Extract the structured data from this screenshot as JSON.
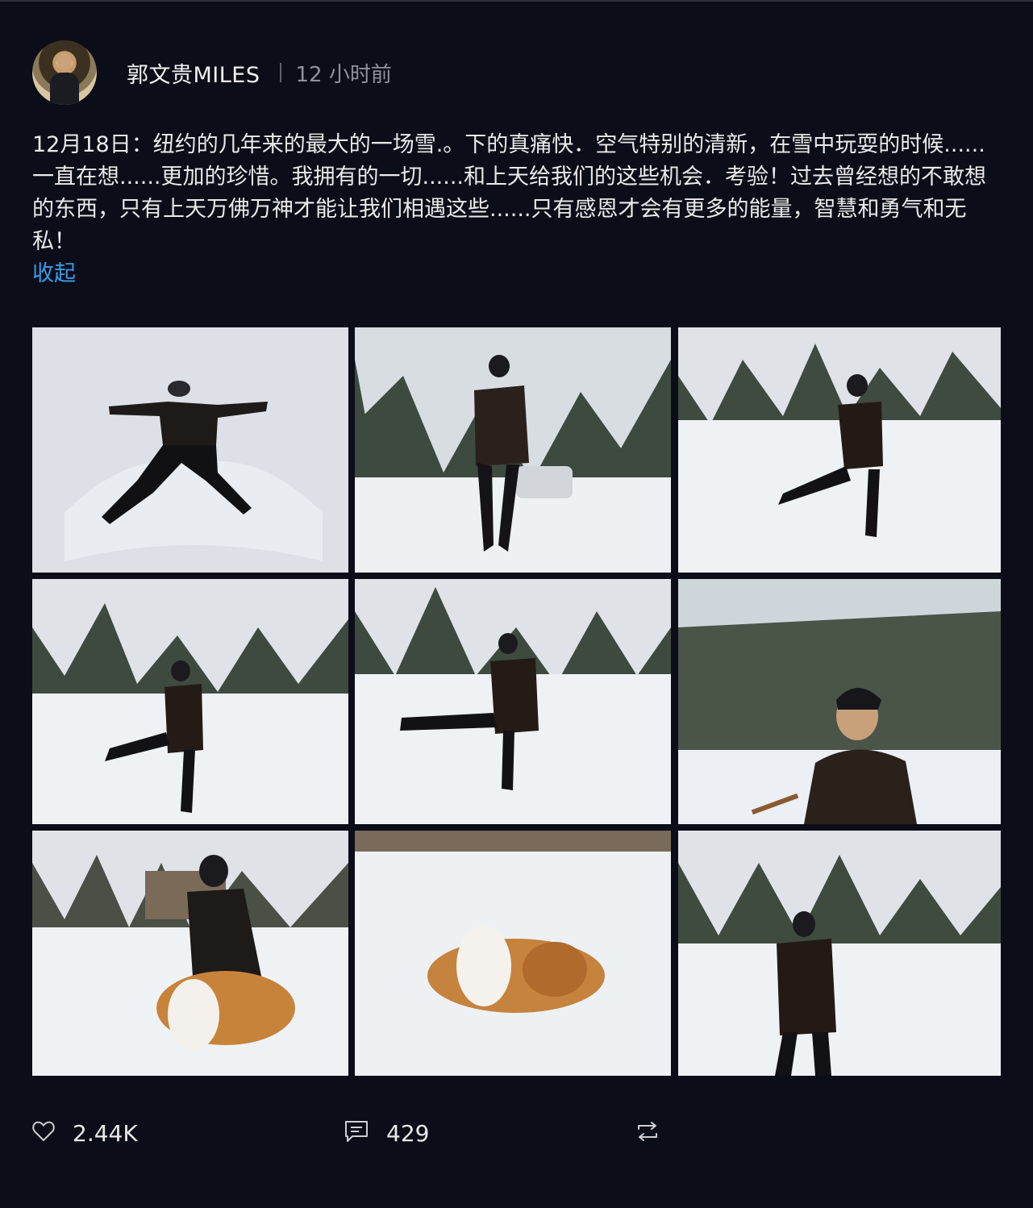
{
  "post": {
    "author": "郭文贵MILES",
    "time": "12 小时前",
    "text": "12月18日：纽约的几年来的最大的一场雪.。下的真痛快．空气特别的清新，在雪中玩耍的时候......一直在想......更加的珍惜。我拥有的一切......和上天给我们的这些机会．考验！过去曾经想的不敢想的东西，只有上天万佛万神才能让我们相遇这些......只有感恩才会有更多的能量，智慧和勇气和无私！",
    "collapse_label": "收起"
  },
  "photos": [
    {
      "name": "snow-angel-photo"
    },
    {
      "name": "standing-cigar-photo"
    },
    {
      "name": "kicking-snow-photo-1"
    },
    {
      "name": "kicking-snow-photo-2"
    },
    {
      "name": "kicking-snow-photo-3"
    },
    {
      "name": "looking-up-photo"
    },
    {
      "name": "dog-play-photo-1"
    },
    {
      "name": "dog-play-photo-2"
    },
    {
      "name": "walking-snow-photo"
    }
  ],
  "actions": {
    "likes": "2.44K",
    "comments": "429",
    "icons": {
      "like": "heart-icon",
      "comment": "comment-icon",
      "repost": "repost-icon"
    }
  },
  "colors": {
    "background": "#0b0e18",
    "text": "#eaeaea",
    "muted": "#8e929c",
    "link": "#3a9ae8"
  }
}
